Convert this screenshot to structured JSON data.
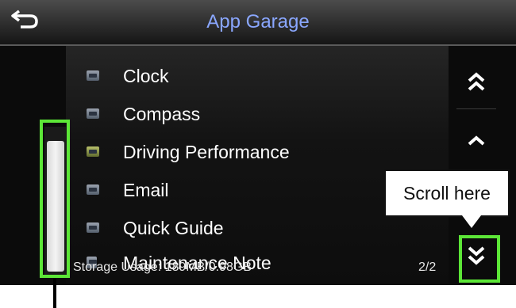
{
  "header": {
    "title": "App Garage",
    "back_icon": "back-arrow-icon"
  },
  "list": {
    "items": [
      {
        "label": "Clock",
        "icon": "clock-app-icon"
      },
      {
        "label": "Compass",
        "icon": "compass-app-icon"
      },
      {
        "label": "Driving Performance",
        "icon": "driving-performance-app-icon"
      },
      {
        "label": "Email",
        "icon": "email-app-icon"
      },
      {
        "label": "Quick Guide",
        "icon": "quick-guide-app-icon"
      },
      {
        "label": "Maintenance Note",
        "icon": "maintenance-note-app-icon"
      }
    ]
  },
  "side_controls": {
    "page_up_icon": "double-chevron-up-icon",
    "line_up_icon": "chevron-up-icon",
    "page_down_icon": "double-chevron-down-icon"
  },
  "footer": {
    "storage": "Storage Usage: 189MB/0.98GB",
    "page": "2/2"
  },
  "annotation": {
    "callout_text": "Scroll here",
    "highlight_color": "#5ce637"
  },
  "colors": {
    "title": "#8aa7ff",
    "background": "#0b0b0b"
  }
}
